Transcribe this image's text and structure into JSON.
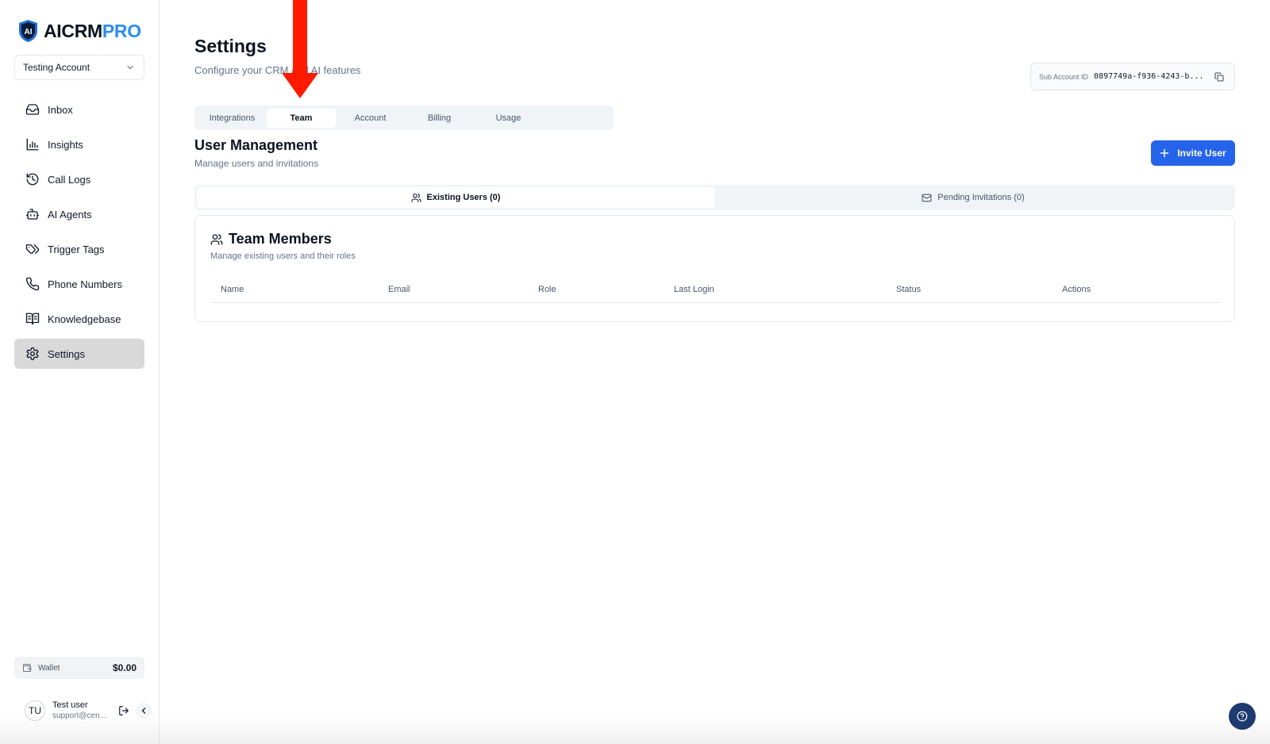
{
  "brand": {
    "name_main": "AICRM",
    "name_accent": "PRO",
    "badge": "AI"
  },
  "account_selector": {
    "value": "Testing Account"
  },
  "sidebar": {
    "items": [
      {
        "label": "Inbox",
        "icon": "inbox-icon"
      },
      {
        "label": "Insights",
        "icon": "bar-chart-icon"
      },
      {
        "label": "Call Logs",
        "icon": "history-icon"
      },
      {
        "label": "AI Agents",
        "icon": "bot-icon"
      },
      {
        "label": "Trigger Tags",
        "icon": "tags-icon"
      },
      {
        "label": "Phone Numbers",
        "icon": "phone-icon"
      },
      {
        "label": "Knowledgebase",
        "icon": "book-icon"
      },
      {
        "label": "Settings",
        "icon": "gear-icon",
        "active": true
      }
    ],
    "wallet": {
      "label": "Wallet",
      "amount": "$0.00"
    },
    "user": {
      "initials": "TU",
      "name": "Test user",
      "email": "support@cen..."
    }
  },
  "header": {
    "title": "Settings",
    "subtitle": "Configure your CRM and AI features",
    "sub_account": {
      "label": "Sub Account ID",
      "value": "0897749a-f936-4243-b..."
    }
  },
  "tabs": [
    {
      "label": "Integrations"
    },
    {
      "label": "Team",
      "active": true
    },
    {
      "label": "Account"
    },
    {
      "label": "Billing"
    },
    {
      "label": "Usage"
    }
  ],
  "user_management": {
    "title": "User Management",
    "subtitle": "Manage users and invitations",
    "invite_label": "Invite User",
    "subtabs": [
      {
        "label": "Existing Users (0)",
        "active": true
      },
      {
        "label": "Pending Invitations (0)"
      }
    ],
    "card": {
      "title": "Team Members",
      "subtitle": "Manage existing users and their roles",
      "columns": [
        "Name",
        "Email",
        "Role",
        "Last Login",
        "Status",
        "Actions"
      ]
    }
  },
  "colors": {
    "primary": "#2563eb",
    "accent_text": "#2a8cf0",
    "annotation_arrow": "#ff1a00",
    "help_button": "#1e3a6e"
  }
}
